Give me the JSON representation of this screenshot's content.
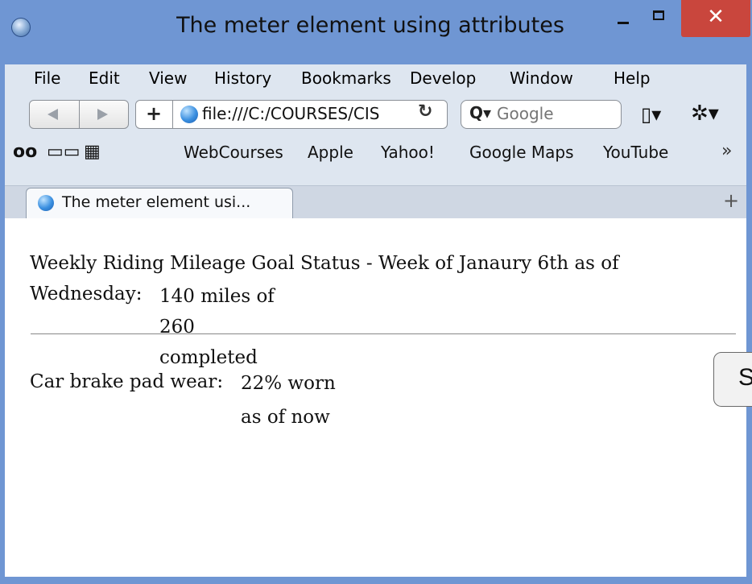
{
  "window": {
    "title": "The meter element using attributes",
    "close_glyph": "✕"
  },
  "menu": [
    "File",
    "Edit",
    "View",
    "History",
    "Bookmarks",
    "Develop",
    "Window",
    "Help"
  ],
  "navbar": {
    "url": "file:///C:/COURSES/CIS",
    "search_placeholder": "Google",
    "add_glyph": "+",
    "reload_glyph": "↻",
    "search_glyph": "Q▾",
    "page_menu_glyph": "▯▾",
    "gear_glyph": "✲▾"
  },
  "bookmarks": {
    "reading_list_glyph": "oo",
    "book_glyph": "▭▭",
    "grid_glyph": "▦",
    "items": [
      "WebCourses",
      "Apple",
      "Yahoo!",
      "Google Maps",
      "YouTube"
    ],
    "more_glyph": "»"
  },
  "tab": {
    "label": "The meter element usi...",
    "new_tab_glyph": "+"
  },
  "content": {
    "mileage_heading_line1": "Weekly Riding Mileage Goal Status - Week of Janaury 6th as of",
    "mileage_heading_line2": "Wednesday:",
    "mileage_fallback": [
      "140 miles of",
      "260",
      "completed"
    ],
    "brake_label": "Car brake pad wear:",
    "brake_fallback": [
      "22% worn",
      "as of now"
    ]
  },
  "start_button": {
    "label": "S"
  }
}
